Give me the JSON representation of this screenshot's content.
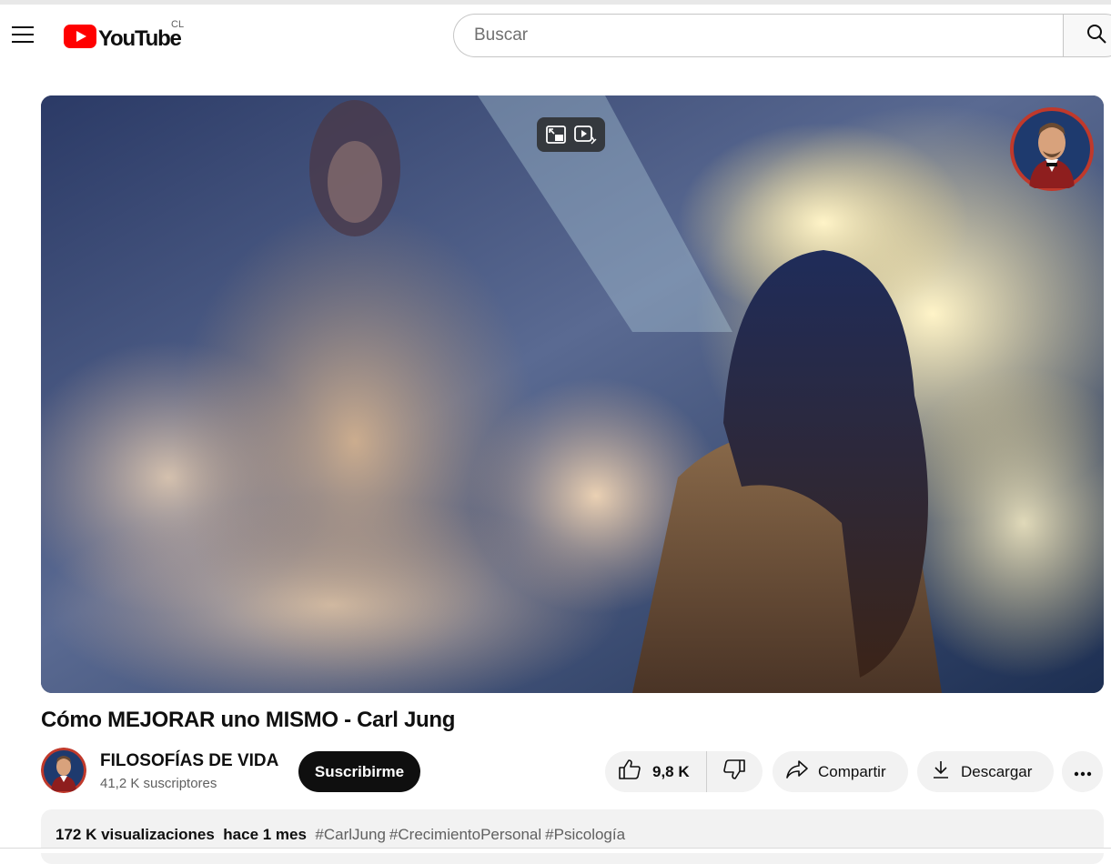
{
  "header": {
    "logo_text": "YouTube",
    "country_code": "CL",
    "search_placeholder": "Buscar",
    "icons": [
      "menu-icon",
      "youtube-logo-icon",
      "search-icon"
    ]
  },
  "player": {
    "overlay_icons": [
      "miniplayer-icon",
      "autoplay-preview-icon"
    ],
    "watermark": "channel-watermark"
  },
  "video": {
    "title": "Cómo MEJORAR uno MISMO - Carl Jung"
  },
  "channel": {
    "name": "FILOSOFÍAS DE VIDA",
    "subscribers": "41,2 K suscriptores",
    "subscribe_label": "Suscribirme"
  },
  "actions": {
    "likes": "9,8 K",
    "share_label": "Compartir",
    "download_label": "Descargar",
    "icons": [
      "thumbs-up-icon",
      "thumbs-down-icon",
      "share-icon",
      "download-icon",
      "more-icon"
    ]
  },
  "description": {
    "views": "172 K visualizaciones",
    "date": "hace 1 mes",
    "hashtags": [
      "#CarlJung",
      "#CrecimientoPersonal",
      "#Psicología"
    ]
  },
  "colors": {
    "brand_red": "#ff0000",
    "subscribe_bg": "#0f0f0f",
    "pill_bg": "#f2f2f2",
    "secondary_text": "#606060"
  }
}
